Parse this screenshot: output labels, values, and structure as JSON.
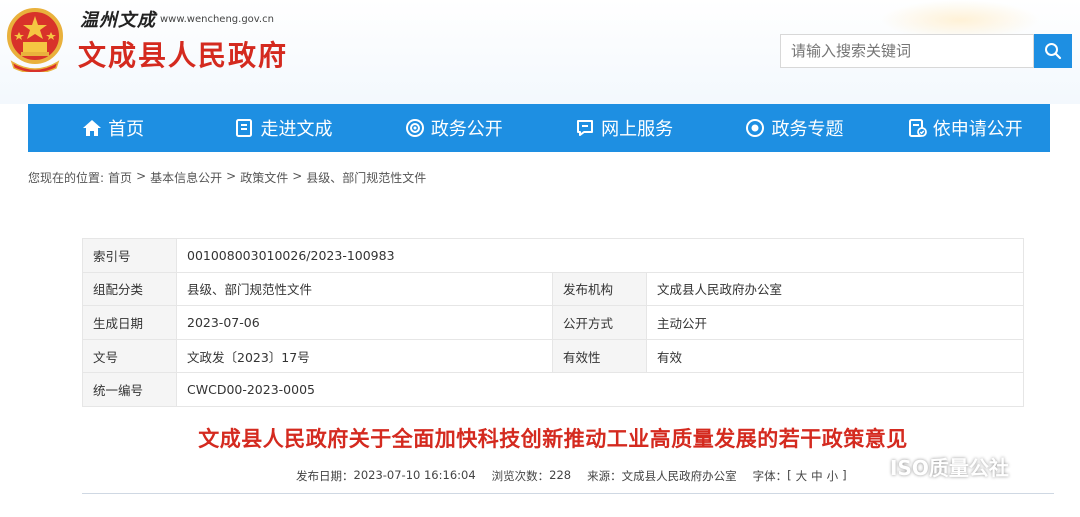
{
  "header": {
    "city_script": "温州文成",
    "url": "www.wencheng.gov.cn",
    "title": "文成县人民政府"
  },
  "search": {
    "placeholder": "请输入搜索关键词",
    "icon": "search-icon"
  },
  "nav": {
    "items": [
      {
        "label": "首页",
        "icon": "home-icon"
      },
      {
        "label": "走进文成",
        "icon": "book-icon"
      },
      {
        "label": "政务公开",
        "icon": "broadcast-icon"
      },
      {
        "label": "网上服务",
        "icon": "chat-icon"
      },
      {
        "label": "政务专题",
        "icon": "eye-icon"
      },
      {
        "label": "依申请公开",
        "icon": "document-check-icon"
      }
    ]
  },
  "breadcrumb": {
    "prefix": "您现在的位置:",
    "items": [
      "首页",
      "基本信息公开",
      "政策文件",
      "县级、部门规范性文件"
    ],
    "sep": ">"
  },
  "info": {
    "index_label": "索引号",
    "index_value": "001008003010026/2023-100983",
    "category_label": "组配分类",
    "category_value": "县级、部门规范性文件",
    "publisher_label": "发布机构",
    "publisher_value": "文成县人民政府办公室",
    "date_label": "生成日期",
    "date_value": "2023-07-06",
    "method_label": "公开方式",
    "method_value": "主动公开",
    "docno_label": "文号",
    "docno_value": "文政发〔2023〕17号",
    "validity_label": "有效性",
    "validity_value": "有效",
    "serial_label": "统一编号",
    "serial_value": "CWCD00-2023-0005"
  },
  "document": {
    "title": "文成县人民政府关于全面加快科技创新推动工业高质量发展的若干政策意见",
    "publish_label": "发布日期：",
    "publish_value": "2023-07-10 16:16:04",
    "views_label": "浏览次数：",
    "views_value": "228",
    "source_label": "来源：",
    "source_value": "文成县人民政府办公室",
    "font_label": "字体：",
    "font_open": "[",
    "font_large": "大",
    "font_medium": "中",
    "font_small": "小",
    "font_close": "]"
  },
  "watermark": {
    "text": "ISO质量公社"
  },
  "colors": {
    "brand_red": "#d42a1f",
    "nav_blue": "#1e8fe2"
  }
}
